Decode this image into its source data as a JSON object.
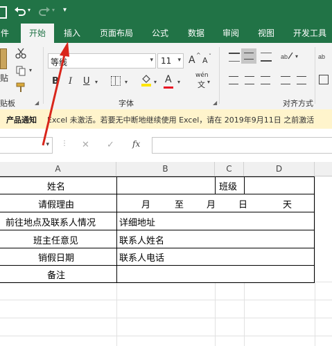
{
  "quick_access": {
    "undo_icon": "undo-icon",
    "redo_icon": "redo-icon",
    "customize_icon": "customize-qat-icon"
  },
  "tabs": [
    "件",
    "开始",
    "插入",
    "页面布局",
    "公式",
    "数据",
    "审阅",
    "视图",
    "开发工具"
  ],
  "ribbon": {
    "paste_label": "贴",
    "clipboard_label": "贴板",
    "font_name": "等线",
    "font_size": "11",
    "font_group_label": "字体",
    "align_group_label": "对齐方式",
    "bold": "B",
    "italic": "I",
    "underline": "U",
    "grow_font": "A",
    "shrink_font": "A",
    "font_color": "A",
    "phonetic": "wén"
  },
  "notification": {
    "title": "产品通知",
    "message": "Excel 未激活。若要无中断地继续使用 Excel，请在 2019年9月11日 之前激活"
  },
  "formula_bar": {
    "fx": "fx",
    "cancel": "✕",
    "confirm": "✓",
    "value": ""
  },
  "columns": [
    "A",
    "B",
    "C",
    "D"
  ],
  "sheet": {
    "r1": {
      "a": "姓名",
      "c": "班级"
    },
    "r2": {
      "a": "请假理由",
      "b1": "月",
      "b2": "至",
      "b3": "月",
      "b4": "日",
      "b5": "天"
    },
    "r3": {
      "a": "前往地点及联系人情况",
      "b": "详细地址"
    },
    "r4": {
      "a": "班主任意见",
      "b": "联系人姓名"
    },
    "r5": {
      "a": "销假日期",
      "b": "联系人电话"
    },
    "r6": {
      "a": "备注"
    }
  },
  "colors": {
    "brand": "#217346",
    "notif_bg": "#fff4cc",
    "annotation": "#d9261c"
  }
}
